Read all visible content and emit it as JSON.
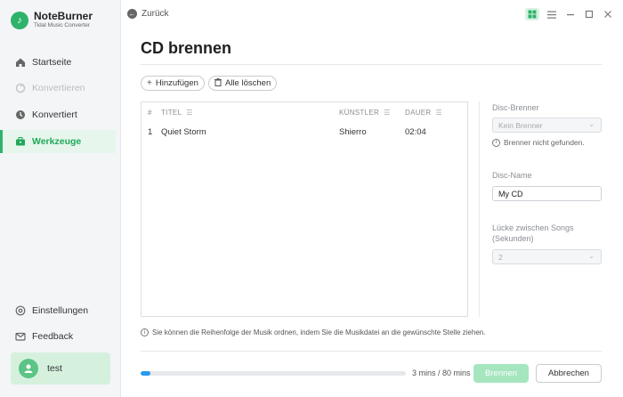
{
  "app": {
    "name": "NoteBurner",
    "subtitle": "Tidal Music Converter"
  },
  "sidebar": {
    "items": [
      {
        "label": "Startseite",
        "icon": "home-icon",
        "state": "normal"
      },
      {
        "label": "Konvertieren",
        "icon": "convert-icon",
        "state": "disabled"
      },
      {
        "label": "Konvertiert",
        "icon": "clock-icon",
        "state": "normal"
      },
      {
        "label": "Werkzeuge",
        "icon": "toolbox-icon",
        "state": "active"
      }
    ],
    "bottom_items": [
      {
        "label": "Einstellungen",
        "icon": "gear-icon"
      },
      {
        "label": "Feedback",
        "icon": "mail-icon"
      }
    ],
    "user": {
      "name": "test"
    }
  },
  "header": {
    "back_label": "Zurück"
  },
  "page": {
    "title": "CD brennen"
  },
  "toolbar": {
    "add_label": "Hinzufügen",
    "clear_label": "Alle löschen"
  },
  "table": {
    "columns": [
      "#",
      "TITEL",
      "KÜNSTLER",
      "DAUER"
    ],
    "rows": [
      {
        "index": "1",
        "title": "Quiet Storm",
        "artist": "Shierro",
        "duration": "02:04"
      }
    ]
  },
  "settings": {
    "burner_label": "Disc-Brenner",
    "burner_value": "Kein Brenner",
    "burner_hint": "Brenner nicht gefunden.",
    "disc_name_label": "Disc-Name",
    "disc_name_value": "My CD",
    "gap_label_line1": "Lücke zwischen Songs",
    "gap_label_line2": "(Sekunden)",
    "gap_value": "2"
  },
  "info_text": "Sie können die Reihenfolge der Musik ordnen, indem Sie die Musikdatei an die gewünschte Stelle ziehen.",
  "footer": {
    "progress_fraction": 0.0375,
    "progress_text": "3 mins / 80 mins",
    "burn_label": "Brennen",
    "cancel_label": "Abbrechen"
  },
  "colors": {
    "accent": "#2fb36b",
    "progress": "#2a9bf0",
    "burn_disabled": "#a5e6bf"
  }
}
